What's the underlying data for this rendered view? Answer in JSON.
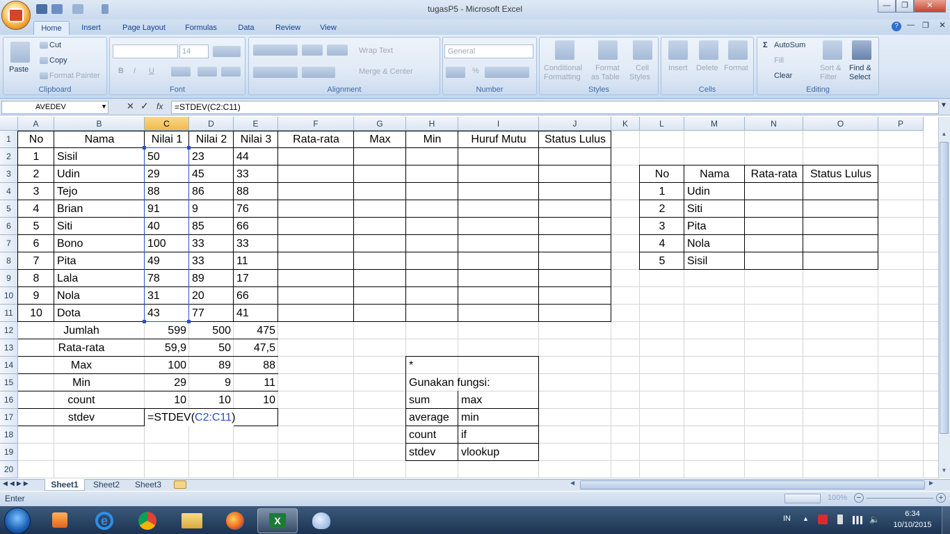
{
  "window": {
    "title": "tugasP5 - Microsoft Excel"
  },
  "ribbon_tabs": [
    "Home",
    "Insert",
    "Page Layout",
    "Formulas",
    "Data",
    "Review",
    "View"
  ],
  "clipboard": {
    "paste": "Paste",
    "cut": "Cut",
    "copy": "Copy",
    "format_painter": "Format Painter",
    "label": "Clipboard"
  },
  "font": {
    "size": "14",
    "label": "Font",
    "bold": "B",
    "italic": "I",
    "underline": "U"
  },
  "alignment": {
    "wrap": "Wrap Text",
    "merge": "Merge & Center",
    "label": "Alignment"
  },
  "number": {
    "format": "General",
    "label": "Number",
    "percent": "%"
  },
  "styles": {
    "conditional": "Conditional",
    "conditional2": "Formatting",
    "format_table": "Format",
    "format_table2": "as Table",
    "cell_styles": "Cell",
    "cell_styles2": "Styles",
    "label": "Styles"
  },
  "cells": {
    "insert": "Insert",
    "delete": "Delete",
    "format": "Format",
    "label": "Cells"
  },
  "editing": {
    "autosum": "AutoSum",
    "fill": "Fill",
    "clear": "Clear",
    "sort": "Sort &",
    "sort2": "Filter",
    "find": "Find &",
    "find2": "Select",
    "label": "Editing"
  },
  "formula_bar": {
    "name_box": "AVEDEV",
    "fx": "fx",
    "content": "=STDEV(C2:C11)"
  },
  "columns": [
    "A",
    "B",
    "C",
    "D",
    "E",
    "F",
    "G",
    "H",
    "I",
    "J",
    "K",
    "L",
    "M",
    "N",
    "O",
    "P"
  ],
  "rows": [
    "1",
    "2",
    "3",
    "4",
    "5",
    "6",
    "7",
    "8",
    "9",
    "10",
    "11",
    "12",
    "13",
    "14",
    "15",
    "16",
    "17",
    "18",
    "19",
    "20"
  ],
  "table_header": [
    "No",
    "Nama",
    "Nilai 1",
    "Nilai 2",
    "Nilai 3",
    "Rata-rata",
    "Max",
    "Min",
    "Huruf Mutu",
    "Status Lulus"
  ],
  "students": [
    [
      "1",
      "Sisil",
      "50",
      "23",
      "44"
    ],
    [
      "2",
      "Udin",
      "29",
      "45",
      "33"
    ],
    [
      "3",
      "Tejo",
      "88",
      "86",
      "88"
    ],
    [
      "4",
      "Brian",
      "91",
      "9",
      "76"
    ],
    [
      "5",
      "Siti",
      "40",
      "85",
      "66"
    ],
    [
      "6",
      "Bono",
      "100",
      "33",
      "33"
    ],
    [
      "7",
      "Pita",
      "49",
      "33",
      "11"
    ],
    [
      "8",
      "Lala",
      "78",
      "89",
      "17"
    ],
    [
      "9",
      "Nola",
      "31",
      "20",
      "66"
    ],
    [
      "10",
      "Dota",
      "43",
      "77",
      "41"
    ]
  ],
  "summary": [
    {
      "label": "Jumlah",
      "c": "599",
      "d": "500",
      "e": "475"
    },
    {
      "label": "Rata-rata",
      "c": "59,9",
      "d": "50",
      "e": "47,5"
    },
    {
      "label": "Max",
      "c": "100",
      "d": "89",
      "e": "88"
    },
    {
      "label": "Min",
      "c": "29",
      "d": "9",
      "e": "11"
    },
    {
      "label": "count",
      "c": "10",
      "d": "10",
      "e": "10"
    },
    {
      "label": "stdev",
      "c": "",
      "d": "",
      "e": ""
    }
  ],
  "editing_cell": {
    "prefix": "=STDEV(",
    "ref": "C2:C11",
    "suffix": ")"
  },
  "side_table": {
    "header": [
      "No",
      "Nama",
      "Rata-rata",
      "Status Lulus"
    ],
    "rows": [
      [
        "1",
        "Udin"
      ],
      [
        "2",
        "Siti"
      ],
      [
        "3",
        "Pita"
      ],
      [
        "4",
        "Nola"
      ],
      [
        "5",
        "Sisil"
      ]
    ]
  },
  "note": {
    "star": "*",
    "title": "Gunakan fungsi:",
    "pairs": [
      [
        "sum",
        "max"
      ],
      [
        "average",
        "min"
      ],
      [
        "count",
        "if"
      ],
      [
        "stdev",
        "vlookup"
      ]
    ]
  },
  "sheets": [
    "Sheet1",
    "Sheet2",
    "Sheet3"
  ],
  "status": {
    "mode": "Enter",
    "zoom": "100%"
  },
  "tray": {
    "lang": "IN",
    "time": "6:34",
    "date": "10/10/2015"
  },
  "colors": {
    "accent": "#f2b94c",
    "selection": "#2b4fc6"
  }
}
